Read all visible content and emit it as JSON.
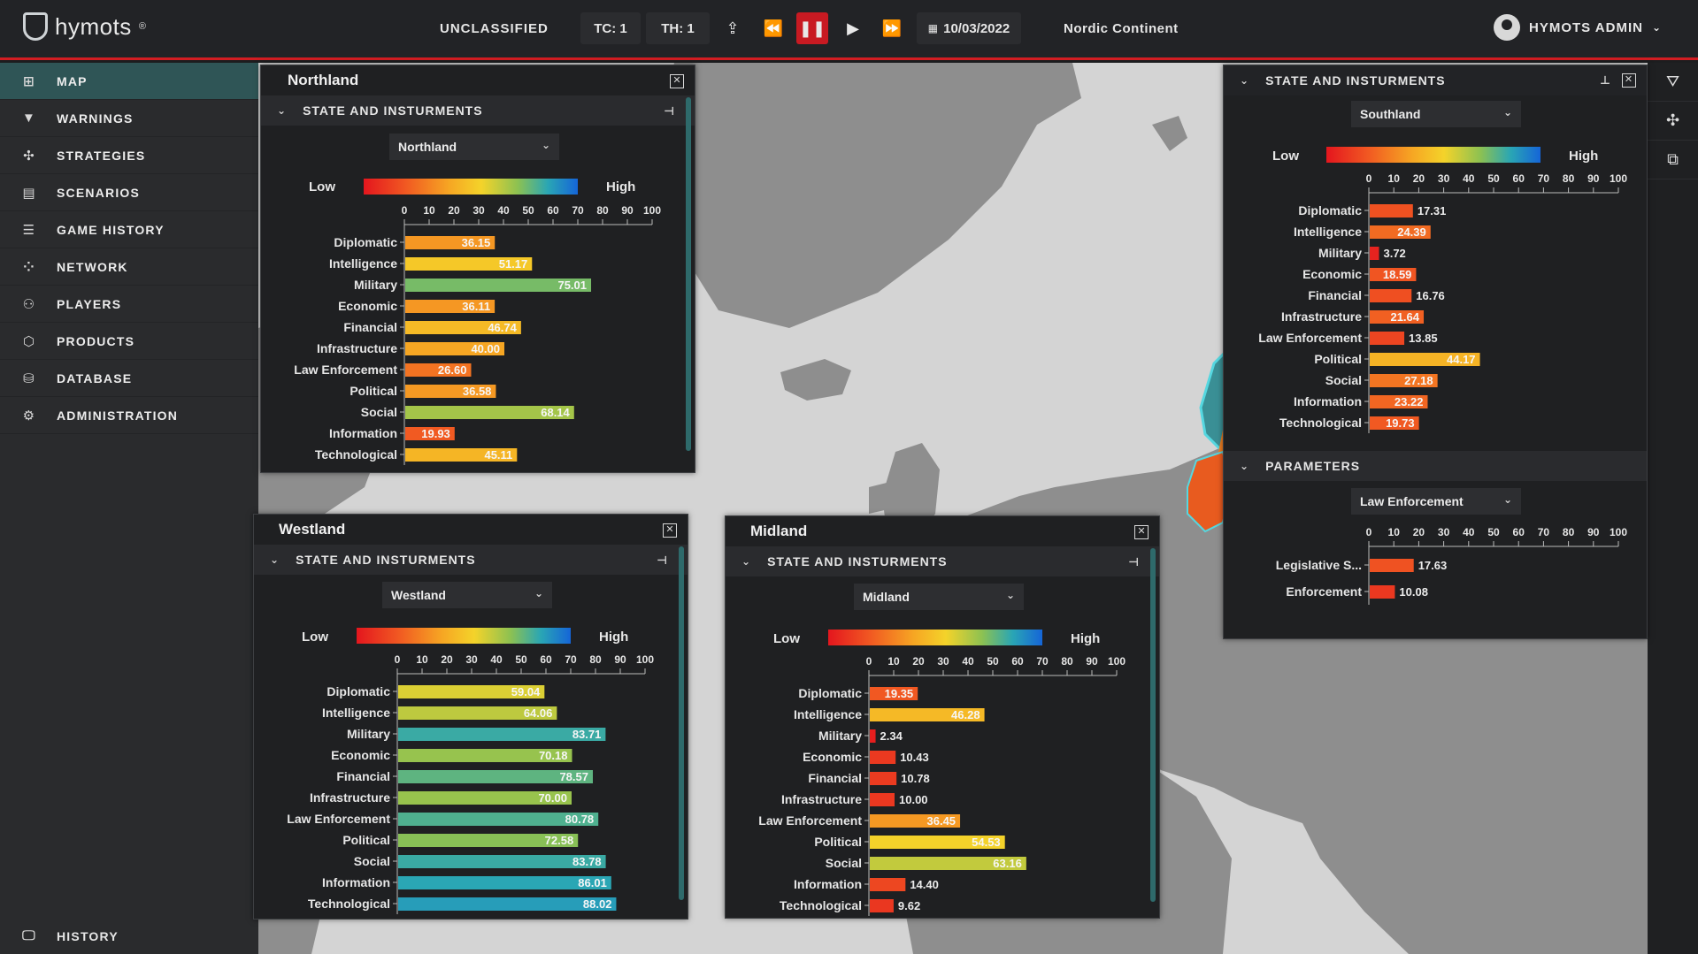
{
  "app": {
    "logo_text": "hymots",
    "logo_mark": "®"
  },
  "topbar": {
    "classification": "UNCLASSIFIED",
    "tc": "TC: 1",
    "th": "TH: 1",
    "date": "10/03/2022",
    "region": "Nordic Continent",
    "user": "HYMOTS ADMIN"
  },
  "sidebar": {
    "items": [
      {
        "label": "MAP",
        "icon": "map-icon"
      },
      {
        "label": "WARNINGS",
        "icon": "warning-icon"
      },
      {
        "label": "STRATEGIES",
        "icon": "strategy-icon"
      },
      {
        "label": "SCENARIOS",
        "icon": "scenario-icon"
      },
      {
        "label": "GAME HISTORY",
        "icon": "list-icon"
      },
      {
        "label": "NETWORK",
        "icon": "network-icon"
      },
      {
        "label": "PLAYERS",
        "icon": "players-icon"
      },
      {
        "label": "PRODUCTS",
        "icon": "box-icon"
      },
      {
        "label": "DATABASE",
        "icon": "database-icon"
      },
      {
        "label": "ADMINISTRATION",
        "icon": "admin-icon"
      }
    ],
    "history_label": "HISTORY"
  },
  "common": {
    "section_state": "STATE AND INSTURMENTS",
    "section_params": "PARAMETERS",
    "low": "Low",
    "high": "High",
    "ticks": [
      "0",
      "10",
      "20",
      "30",
      "40",
      "50",
      "60",
      "70",
      "80",
      "90",
      "100"
    ]
  },
  "panels": {
    "northland": {
      "title": "Northland",
      "selected": "Northland"
    },
    "westland": {
      "title": "Westland",
      "selected": "Westland"
    },
    "midland": {
      "title": "Midland",
      "selected": "Midland"
    },
    "southland": {
      "selected": "Southland",
      "param_selected": "Law Enforcement"
    }
  },
  "chart_data": [
    {
      "id": "northland",
      "type": "bar",
      "orientation": "horizontal",
      "categories": [
        "Diplomatic",
        "Intelligence",
        "Military",
        "Economic",
        "Financial",
        "Infrastructure",
        "Law Enforcement",
        "Political",
        "Social",
        "Information",
        "Technological"
      ],
      "values": [
        36.15,
        51.17,
        75.01,
        36.11,
        46.74,
        40.0,
        26.6,
        36.58,
        68.14,
        19.93,
        45.11
      ],
      "xlim": [
        0,
        100
      ]
    },
    {
      "id": "westland",
      "type": "bar",
      "orientation": "horizontal",
      "categories": [
        "Diplomatic",
        "Intelligence",
        "Military",
        "Economic",
        "Financial",
        "Infrastructure",
        "Law Enforcement",
        "Political",
        "Social",
        "Information",
        "Technological"
      ],
      "values": [
        59.04,
        64.06,
        83.71,
        70.18,
        78.57,
        70.0,
        80.78,
        72.58,
        83.78,
        86.01,
        88.02
      ],
      "xlim": [
        0,
        100
      ]
    },
    {
      "id": "midland",
      "type": "bar",
      "orientation": "horizontal",
      "categories": [
        "Diplomatic",
        "Intelligence",
        "Military",
        "Economic",
        "Financial",
        "Infrastructure",
        "Law Enforcement",
        "Political",
        "Social",
        "Information",
        "Technological"
      ],
      "values": [
        19.35,
        46.28,
        2.34,
        10.43,
        10.78,
        10.0,
        36.45,
        54.53,
        63.16,
        14.4,
        9.62
      ],
      "xlim": [
        0,
        100
      ]
    },
    {
      "id": "southland",
      "type": "bar",
      "orientation": "horizontal",
      "categories": [
        "Diplomatic",
        "Intelligence",
        "Military",
        "Economic",
        "Financial",
        "Infrastructure",
        "Law Enforcement",
        "Political",
        "Social",
        "Information",
        "Technological"
      ],
      "values": [
        17.31,
        24.39,
        3.72,
        18.59,
        16.76,
        21.64,
        13.85,
        44.17,
        27.18,
        23.22,
        19.73
      ],
      "xlim": [
        0,
        100
      ]
    },
    {
      "id": "southland-params",
      "type": "bar",
      "orientation": "horizontal",
      "categories": [
        "Legislative S...",
        "Enforcement"
      ],
      "values": [
        17.63,
        10.08
      ],
      "xlim": [
        0,
        100
      ]
    }
  ],
  "colors": {
    "accent": "#c81a22",
    "teal": "#2f5556",
    "panel": "#1f2022"
  }
}
